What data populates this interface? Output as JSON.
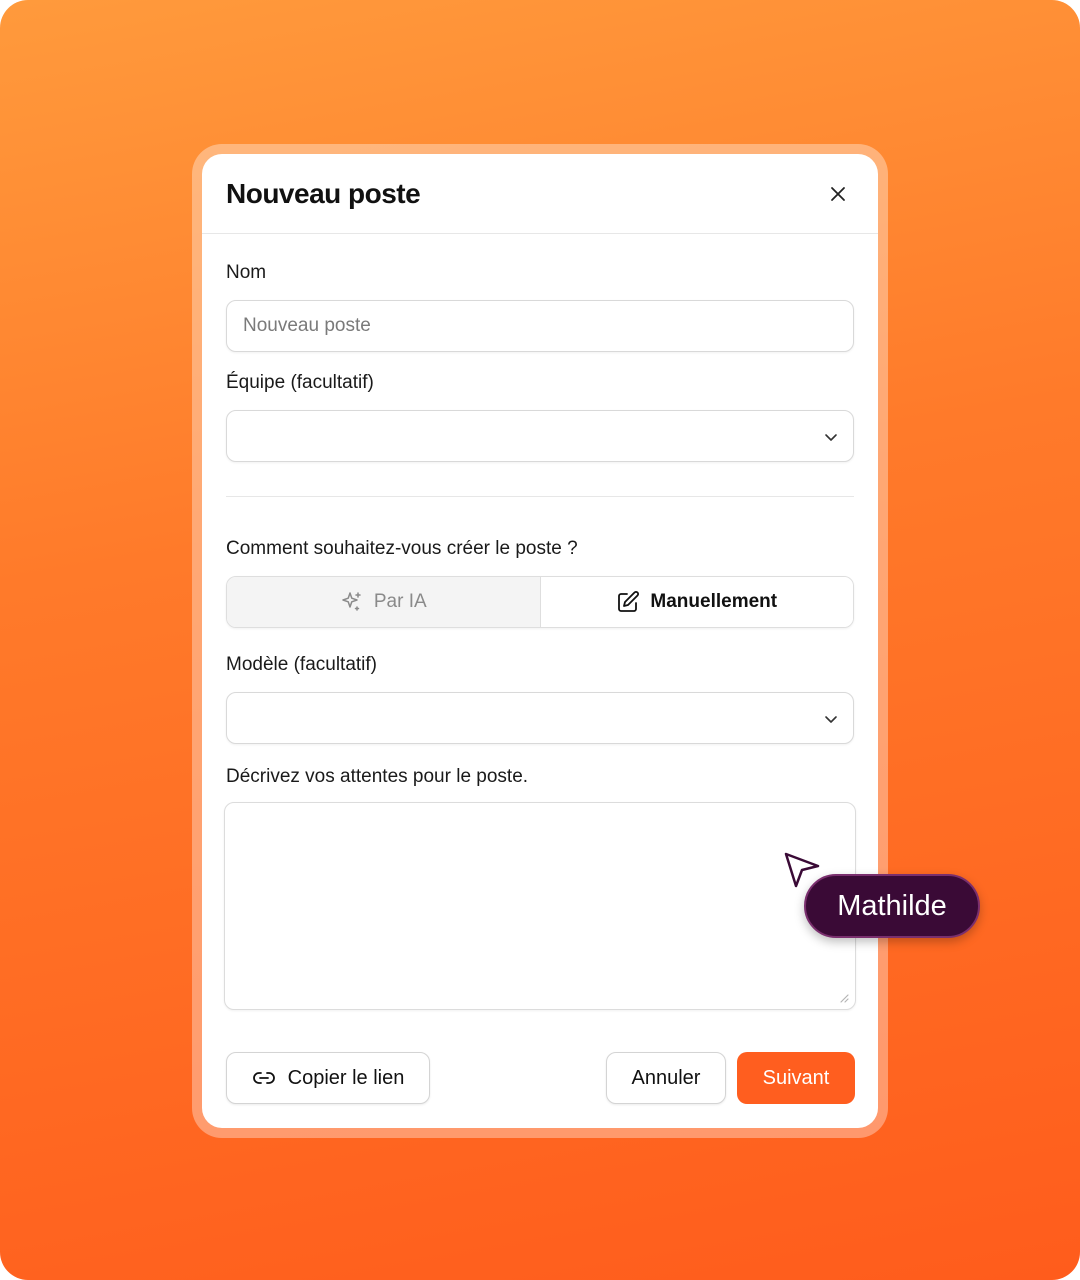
{
  "modal": {
    "title": "Nouveau poste",
    "name_label": "Nom",
    "name_placeholder": "Nouveau poste",
    "team_label": "Équipe (facultatif)",
    "team_value": "",
    "creation_question": "Comment souhaitez-vous créer le poste ?",
    "mode_ai_label": "Par IA",
    "mode_manual_label": "Manuellement",
    "selected_mode": "Manuellement",
    "template_label": "Modèle (facultatif)",
    "template_value": "",
    "description_label": "Décrivez vos attentes pour le poste.",
    "description_value": "",
    "copy_link_label": "Copier le lien",
    "cancel_label": "Annuler",
    "next_label": "Suivant"
  },
  "cursor": {
    "user_name": "Mathilde",
    "color": "#3a0a36"
  },
  "colors": {
    "accent": "#ff5e1f",
    "background_top": "#ff9a3c",
    "background_bottom": "#ff5c1c"
  }
}
